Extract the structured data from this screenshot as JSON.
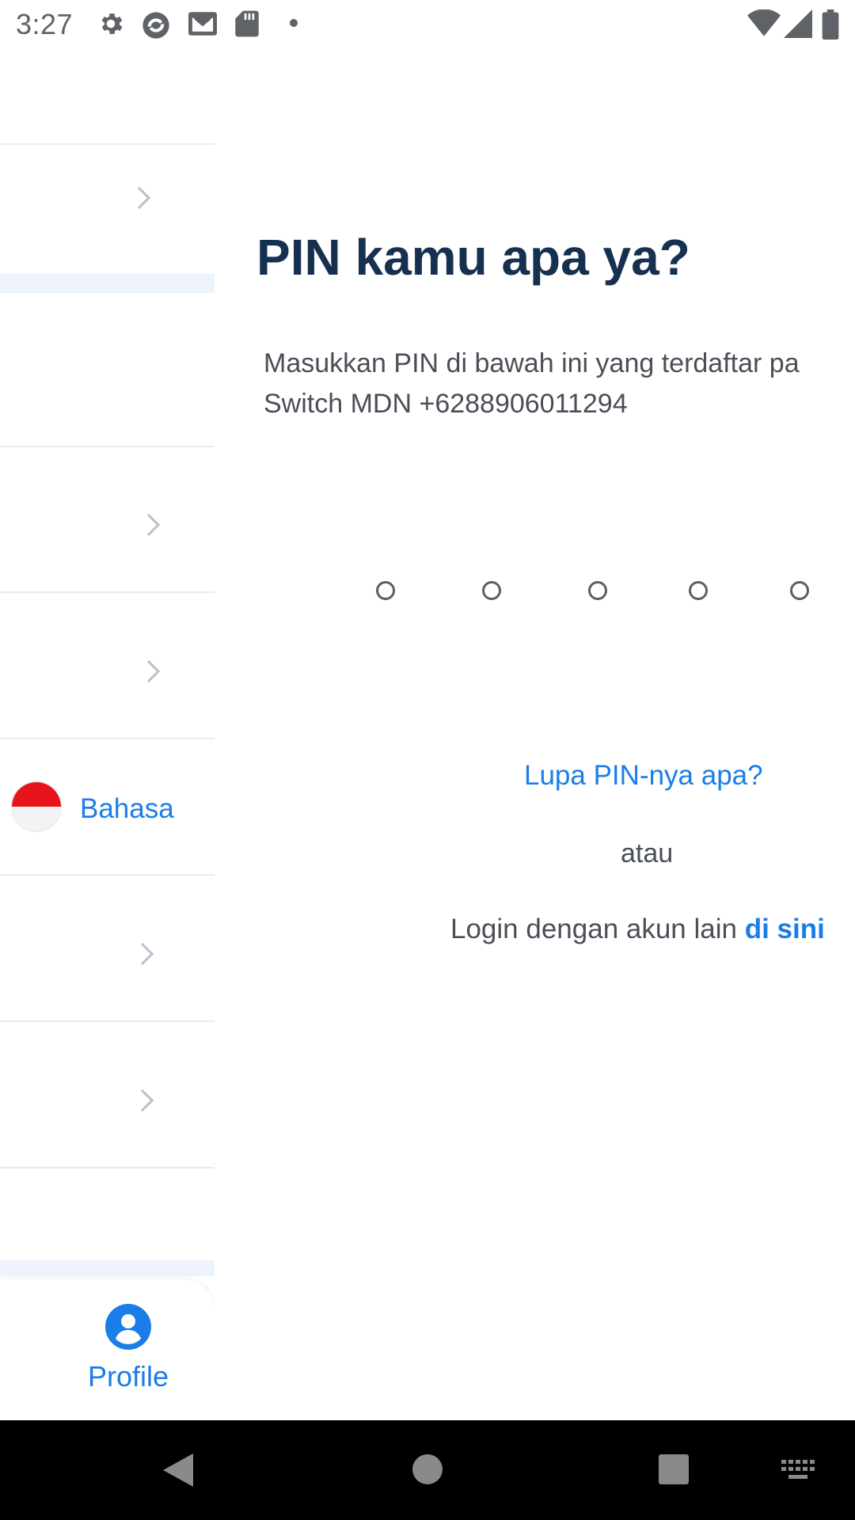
{
  "status_bar": {
    "time": "3:27",
    "icons": [
      "settings-icon",
      "app-refresh-icon",
      "mail-icon",
      "sd-card-icon",
      "notification-dot-icon",
      "wifi-icon",
      "signal-icon",
      "battery-icon"
    ]
  },
  "background_panel": {
    "language_label": "Bahasa",
    "tab_profile_label": "Profile"
  },
  "pin_screen": {
    "title": "PIN kamu apa ya?",
    "description_line1": "Masukkan PIN di bawah ini yang terdaftar pa",
    "description_line2": "Switch MDN +6288906011294",
    "pin_length": 5,
    "forgot_pin_link": "Lupa PIN-nya apa?",
    "or_text": "atau",
    "login_other_text": "Login dengan akun lain ",
    "login_other_link": "di sini"
  },
  "colors": {
    "accent": "#1a7de8",
    "title": "#16304f",
    "body_text": "#4a4f57"
  },
  "nav_bar": {
    "icons": [
      "back-icon",
      "home-icon",
      "recents-icon",
      "keyboard-icon"
    ]
  }
}
